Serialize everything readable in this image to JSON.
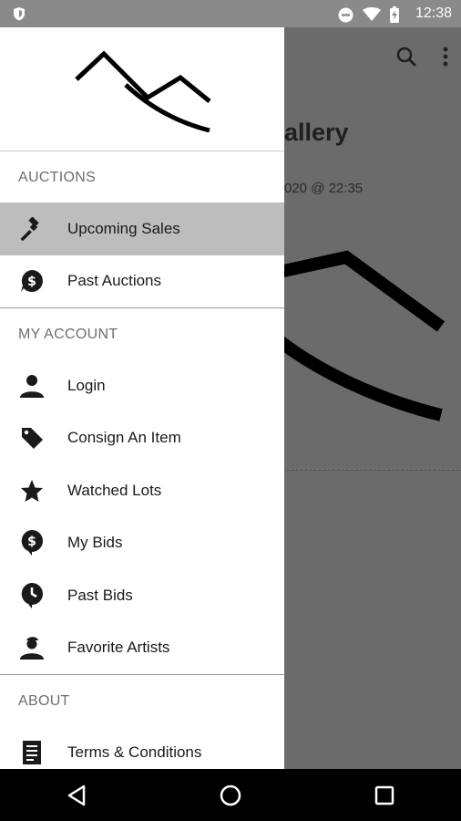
{
  "status_bar": {
    "time": "12:38",
    "icons": [
      "shield-icon",
      "do-not-disturb-icon",
      "wifi-icon",
      "battery-charging-icon"
    ]
  },
  "background": {
    "title_fragment": "allery",
    "date_fragment": "020 @ 22:35"
  },
  "drawer": {
    "sections": [
      {
        "label": "AUCTIONS",
        "items": [
          {
            "label": "Upcoming Sales",
            "icon": "gavel-icon",
            "active": true
          },
          {
            "label": "Past Auctions",
            "icon": "dollar-bubble-icon",
            "active": false
          }
        ]
      },
      {
        "label": "MY ACCOUNT",
        "items": [
          {
            "label": "Login",
            "icon": "person-icon",
            "active": false
          },
          {
            "label": "Consign An Item",
            "icon": "tag-icon",
            "active": false
          },
          {
            "label": "Watched Lots",
            "icon": "star-icon",
            "active": false
          },
          {
            "label": "My Bids",
            "icon": "dollar-pin-icon",
            "active": false
          },
          {
            "label": "Past Bids",
            "icon": "clock-pin-icon",
            "active": false
          },
          {
            "label": "Favorite Artists",
            "icon": "artist-icon",
            "active": false
          }
        ]
      },
      {
        "label": "ABOUT",
        "items": [
          {
            "label": "Terms & Conditions",
            "icon": "document-icon",
            "active": false
          }
        ]
      }
    ]
  },
  "nav_bar": {
    "buttons": [
      "back-icon",
      "home-icon",
      "recents-icon"
    ]
  }
}
